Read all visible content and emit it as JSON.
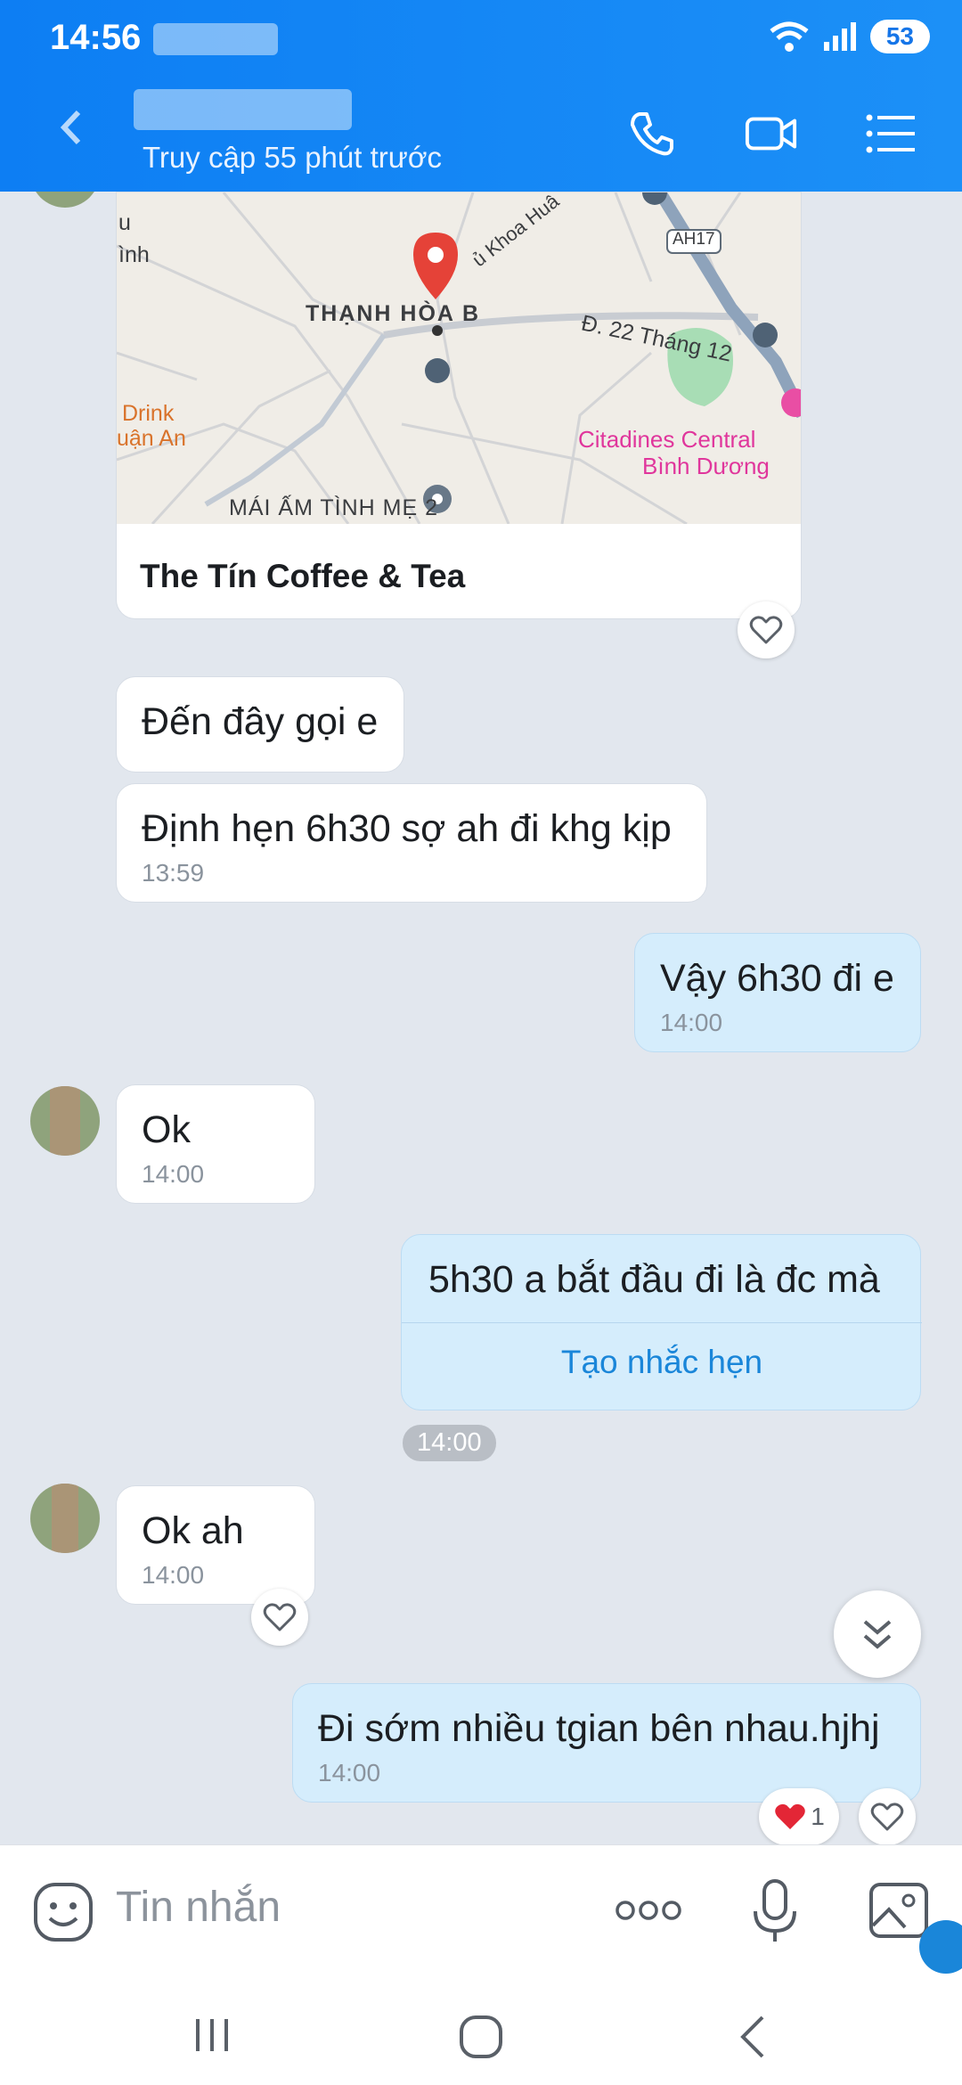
{
  "status_bar": {
    "time": "14:56",
    "battery": "53"
  },
  "header": {
    "subtitle": "Truy cập 55 phút trước"
  },
  "map": {
    "title": "The Tín Coffee & Tea",
    "labels": [
      "THẠNH HÒA B",
      "Đ. 22 Tháng 12",
      "Citadines Central",
      "Bình Dương",
      "Drink",
      "uận An",
      "MÁI ẤM TÌNH MẸ 2",
      "AH17",
      "ủ Khoa Huâ",
      "u",
      "ình"
    ]
  },
  "messages": [
    {
      "text": "Đến đây gọi e",
      "time": ""
    },
    {
      "text": "Định hẹn 6h30 sợ ah đi khg kịp",
      "time": "13:59"
    },
    {
      "text": "Vậy 6h30 đi e",
      "time": "14:00"
    },
    {
      "text": "Ok",
      "time": "14:00"
    },
    {
      "text": "5h30 a bắt đầu đi là đc mà",
      "time": "14:00",
      "action": "Tạo nhắc hẹn"
    },
    {
      "text": "Ok ah",
      "time": "14:00"
    },
    {
      "text": "Đi sớm nhiều tgian bên nhau.hjhj",
      "time": "14:00",
      "reaction_count": "1"
    }
  ],
  "input": {
    "placeholder": "Tin nhắn"
  },
  "colors": {
    "header": "#0d7ef3",
    "my_bubble": "#d5edfc",
    "accent": "#1a86d9",
    "background": "#e2e7ee"
  }
}
